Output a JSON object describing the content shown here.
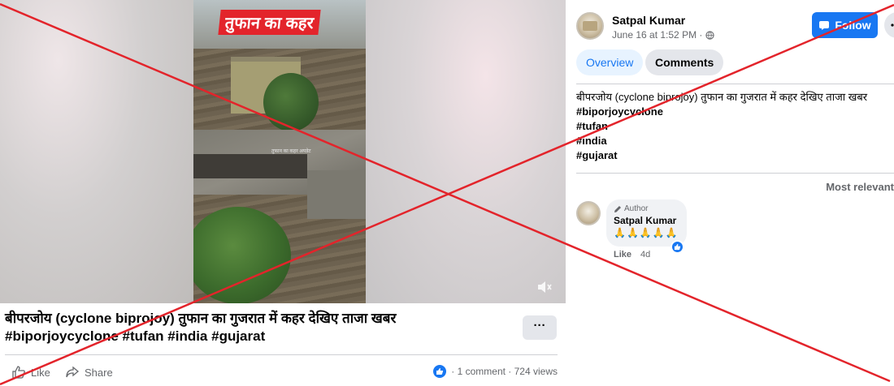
{
  "video": {
    "caption": "तुफान का कहर",
    "watermark": "तुफान का कहर अपडेट"
  },
  "post": {
    "title": "बीपरजोय (cyclone biprojoy) तुफान का गुजरात में कहर देखिए ताजा खबर",
    "hashtags": "#biporjoycyclone #tufan #india #gujarat",
    "more_label": "···",
    "like_label": "Like",
    "share_label": "Share",
    "stats": "· 1 comment · 724 views"
  },
  "poster": {
    "name": "Satpal Kumar",
    "date": "June 16 at 1:52 PM ·",
    "follow_label": "Follow"
  },
  "tabs": {
    "overview": "Overview",
    "comments": "Comments"
  },
  "description": {
    "line1": "बीपरजोय (cyclone biprojoy) तुफान का गुजरात में कहर देखिए ताजा खबर",
    "tags": [
      "#biporjoycyclone",
      "#tufan",
      "#india",
      "#gujarat"
    ]
  },
  "comments_section": {
    "sort_label": "Most relevant",
    "comment": {
      "author_badge": "Author",
      "name": "Satpal Kumar",
      "text": "🙏🙏🙏🙏🙏",
      "like_label": "Like",
      "time": "4d"
    }
  },
  "colors": {
    "accent": "#1877f2",
    "overlay_x": "#e3242b"
  }
}
